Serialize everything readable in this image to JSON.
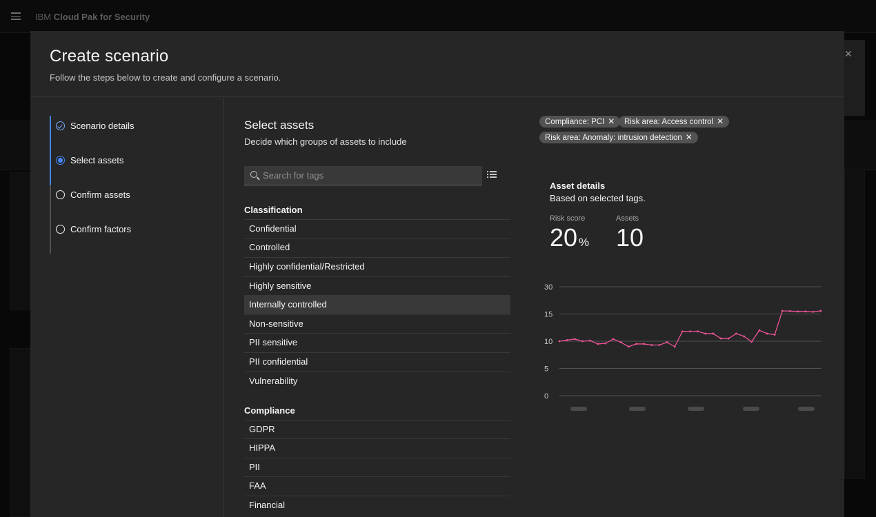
{
  "app": {
    "title_prefix": "IBM",
    "title_bold": "Cloud Pak for Security"
  },
  "modal": {
    "title": "Create scenario",
    "subtitle": "Follow the steps below to create and configure a scenario."
  },
  "steps": [
    {
      "label": "Scenario details",
      "state": "complete"
    },
    {
      "label": "Select assets",
      "state": "current"
    },
    {
      "label": "Confirm assets",
      "state": "incomplete"
    },
    {
      "label": "Confirm factors",
      "state": "incomplete"
    }
  ],
  "assets": {
    "title": "Select assets",
    "description": "Decide which groups of assets to include",
    "search_placeholder": "Search for tags",
    "groups": [
      {
        "title": "Classification",
        "items": [
          "Confidential",
          "Controlled",
          "Highly confidential/Restricted",
          "Highly sensitive",
          "Internally controlled",
          "Non-sensitive",
          "PII sensitive",
          "PII confidential",
          "Vulnerability"
        ],
        "highlighted": "Internally controlled"
      },
      {
        "title": "Compliance",
        "items": [
          "GDPR",
          "HIPPA",
          "PII",
          "FAA",
          "Financial"
        ]
      }
    ]
  },
  "selected_tags": [
    "Compliance: PCI",
    "Risk area: Access control",
    "Risk area: Anomaly: intrusion detection"
  ],
  "details": {
    "title": "Asset details",
    "subtitle": "Based on selected tags.",
    "risk_label": "Risk score",
    "risk_value": "20",
    "risk_unit": "%",
    "assets_label": "Assets",
    "assets_value": "10"
  },
  "chart_data": {
    "type": "line",
    "title": "",
    "xlabel": "",
    "ylabel": "",
    "y_ticks": [
      30,
      15,
      10,
      5,
      0
    ],
    "series_color": "#ee5396",
    "grid": true,
    "values": [
      10,
      10.2,
      10.4,
      10,
      10.1,
      9.5,
      9.6,
      10.4,
      9.8,
      9,
      9.5,
      9.5,
      9.3,
      9.3,
      9.8,
      9,
      11.8,
      11.8,
      11.8,
      11.4,
      11.4,
      10.5,
      10.5,
      11.4,
      10.9,
      9.9,
      12,
      11.4,
      11.2,
      16.7,
      16.6,
      16.4,
      16.4,
      16.2,
      16.7
    ]
  }
}
